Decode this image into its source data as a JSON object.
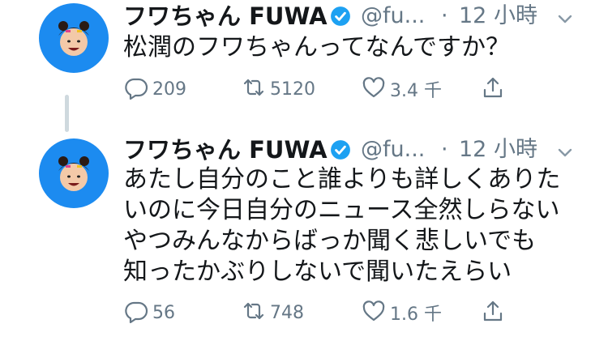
{
  "tweets": [
    {
      "author_name": "フワちゃん FUWA",
      "handle": "@fu...",
      "separator": "·",
      "time": "12 小時",
      "lines": [
        "松潤のフワちゃんってなんですか？"
      ],
      "stats": {
        "replies": "209",
        "retweets": "5120",
        "likes": "3.4 千"
      }
    },
    {
      "author_name": "フワちゃん FUWA",
      "handle": "@fu...",
      "separator": "·",
      "time": "12 小時",
      "lines": [
        "あたし自分のこと誰よりも詳しくありた",
        "いのに今日自分のニュース全然しらない",
        "やつみんなからばっか聞く悲しいでも",
        "知ったかぶりしないで聞いたえらい"
      ],
      "stats": {
        "replies": "56",
        "retweets": "748",
        "likes": "1.6 千"
      }
    }
  ],
  "colors": {
    "accent": "#1da1f2",
    "secondary_text": "#657786",
    "avatar_bg": "#1c8bf0"
  },
  "icons": [
    "avatar",
    "verified-badge-icon",
    "chevron-down-icon",
    "reply-icon",
    "retweet-icon",
    "like-icon",
    "share-icon"
  ]
}
